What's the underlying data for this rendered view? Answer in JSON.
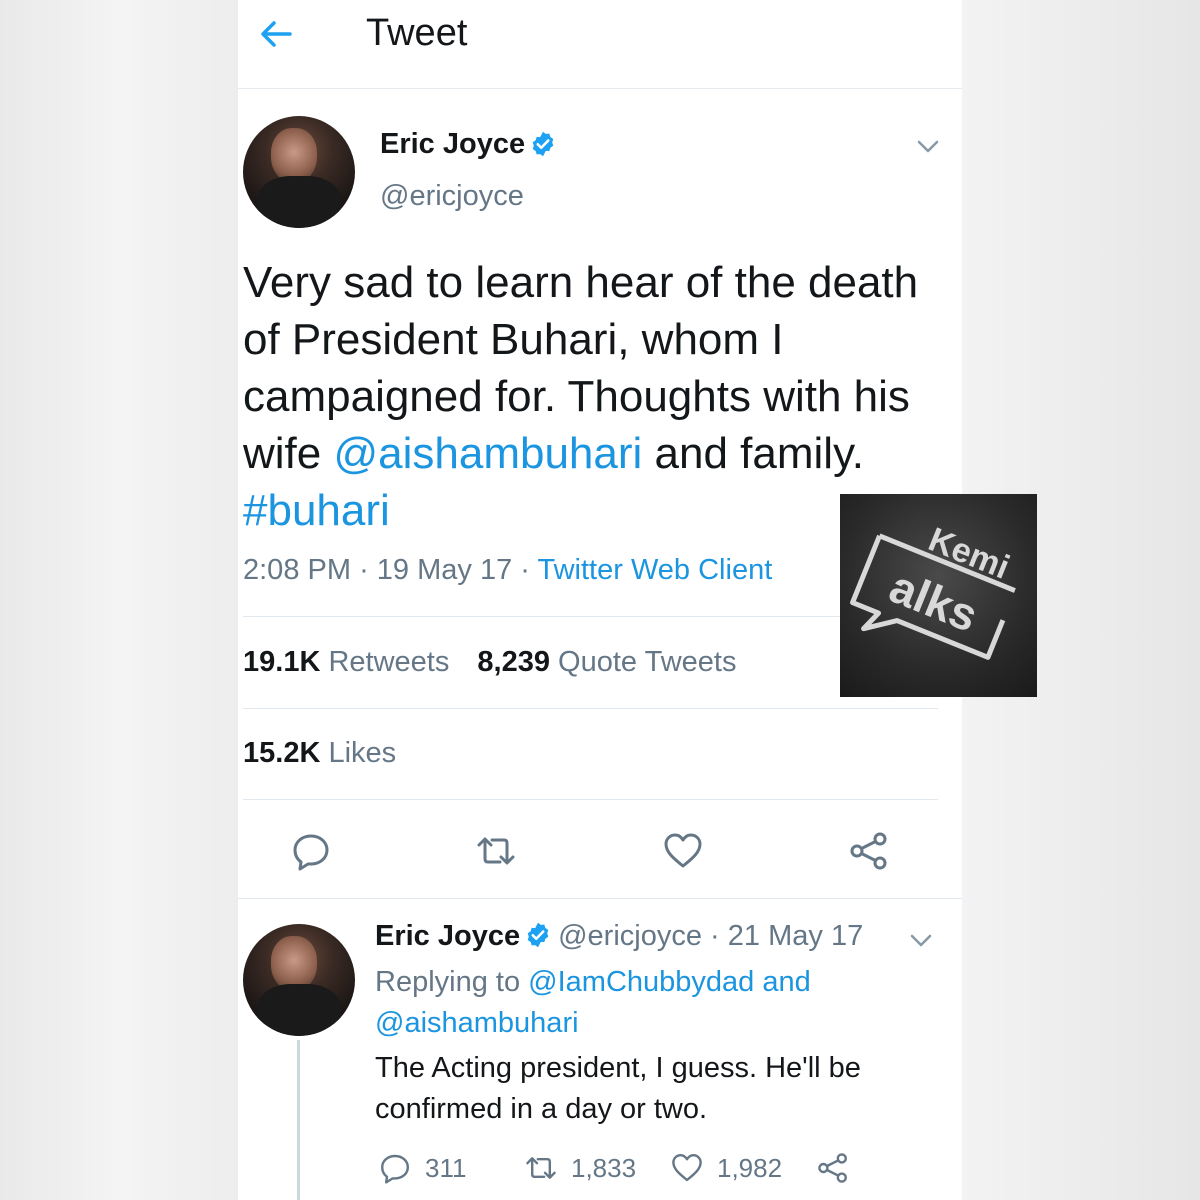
{
  "header": {
    "title": "Tweet"
  },
  "tweet": {
    "name": "Eric Joyce",
    "handle": "@ericjoyce",
    "text_plain_1": "Very sad to learn hear of the death of President Buhari, whom I campaigned for. Thoughts with his wife ",
    "mention": "@aishambuhari",
    "text_plain_2": " and family. ",
    "hashtag": "#buhari",
    "time": "2:08 PM",
    "sep": "·",
    "date": "19 May 17",
    "client": "Twitter Web Client",
    "retweets_count": "19.1K",
    "retweets_label": "Retweets",
    "quotes_count": "8,239",
    "quotes_label": "Quote Tweets",
    "likes_count": "15.2K",
    "likes_label": "Likes",
    "actions": [
      "reply-icon",
      "retweet-icon",
      "like-icon",
      "share-icon"
    ]
  },
  "reply": {
    "name": "Eric Joyce",
    "handle": "@ericjoyce",
    "sep": "·",
    "date": "21 May 17",
    "replying_label": "Replying to",
    "replying_to_1": "@IamChubbydad",
    "replying_and": "and",
    "replying_to_2": "@aishambuhari",
    "text": "The Acting president, I guess. He'll be confirmed in a day or two.",
    "reply_count": "311",
    "retweet_count": "1,833",
    "like_count": "1,982"
  },
  "watermark": {
    "line1": "Kemi",
    "line2": "alks"
  },
  "colors": {
    "accent": "#1da1f2",
    "link": "#1b95e0",
    "text": "#14171a",
    "muted": "#657786"
  }
}
